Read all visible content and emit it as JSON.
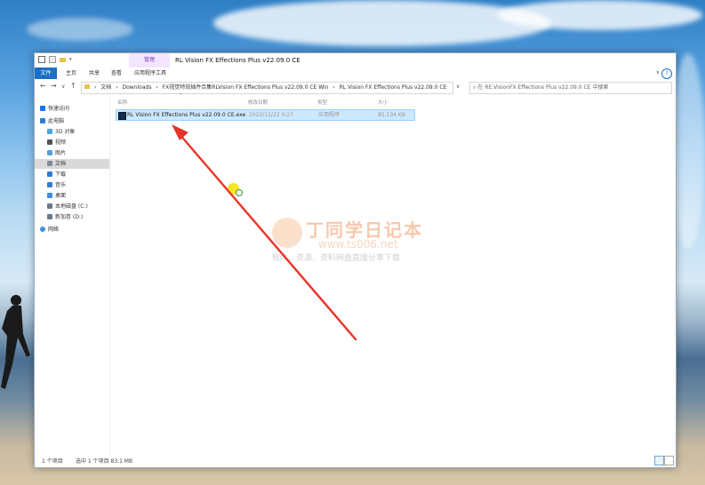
{
  "window": {
    "title": "RL Vision FX Effections Plus v22.09.0 CE",
    "context_tab": "管理"
  },
  "ribbon": {
    "tabs": [
      "文件",
      "主页",
      "共享",
      "查看",
      "应用程序工具"
    ]
  },
  "address": {
    "segments": [
      "文档",
      "Downloads",
      "FX视觉特效插件合集RLVision FX Effections Plus v22.09.0 CE Win",
      "RL Vision FX Effections Plus v22.09.0 CE"
    ],
    "search_placeholder": "在 RE:VisionFX Effections Plus v22.09.0 CE 中搜索"
  },
  "nav_pane": {
    "items": [
      {
        "label": "快速访问",
        "icon": "star-icon",
        "color": "#1a73e8"
      },
      {
        "label": "此电脑",
        "icon": "computer-icon",
        "color": "#2d7bd6"
      },
      {
        "label": "3D 对象",
        "icon": "cube-icon",
        "color": "#4ba3e3"
      },
      {
        "label": "视频",
        "icon": "video-icon",
        "color": "#555555"
      },
      {
        "label": "图片",
        "icon": "picture-icon",
        "color": "#5aa0d8"
      },
      {
        "label": "文档",
        "icon": "document-icon",
        "color": "#7f8c9a"
      },
      {
        "label": "下载",
        "icon": "download-icon",
        "color": "#2d7bd6"
      },
      {
        "label": "音乐",
        "icon": "music-icon",
        "color": "#3a7bd5"
      },
      {
        "label": "桌面",
        "icon": "desktop-icon",
        "color": "#3d8fe0"
      },
      {
        "label": "本地磁盘 (C:)",
        "icon": "drive-icon",
        "color": "#6a7a8a"
      },
      {
        "label": "新加卷 (D:)",
        "icon": "drive-icon",
        "color": "#6a7a8a"
      },
      {
        "label": "网络",
        "icon": "network-icon",
        "color": "#3d8fe0"
      }
    ]
  },
  "columns": [
    "名称",
    "修改日期",
    "类型",
    "大小"
  ],
  "files": [
    {
      "name": "RL Vision FX Effections Plus v22.09.0 CE.exe",
      "modified": "2022/11/22 0:27",
      "type": "应用程序",
      "size": "85,134 KB"
    }
  ],
  "status": {
    "count": "1 个项目",
    "selected": "选中 1 个项目 83.1 MB"
  },
  "watermark": {
    "title": "丁同学日记本",
    "url": "www.ts006.net",
    "slogan": "软件、资源、资料网盘直接分享下载"
  },
  "colors": {
    "accent": "#1a6fc6",
    "selection": "#cce8ff",
    "arrow": "#e8332a"
  }
}
